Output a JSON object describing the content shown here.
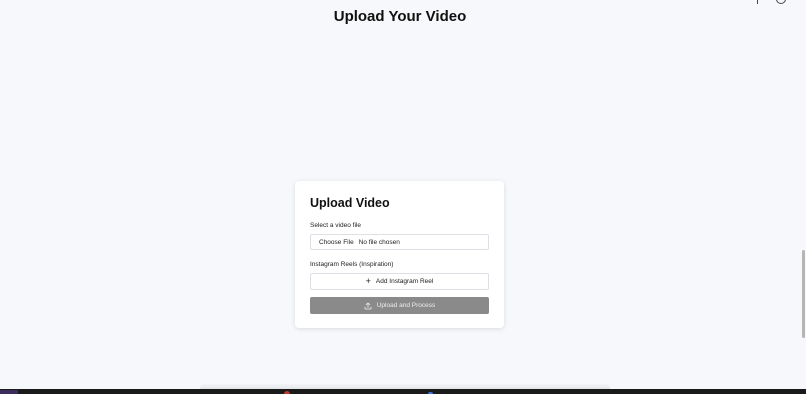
{
  "page": {
    "title": "Upload Your Video"
  },
  "card": {
    "title": "Upload Video",
    "video_label": "Select a video file",
    "file_button_label": "Choose File",
    "file_status": "No file chosen",
    "reels_label": "Instagram Reels (Inspiration)",
    "add_reel_label": "Add Instagram Reel",
    "submit_label": "Upload and Process",
    "submit_disabled": true
  },
  "icons": {
    "add": "plus-icon",
    "submit": "upload-icon"
  },
  "colors": {
    "background": "#f7f8fb",
    "card": "#ffffff",
    "submit_disabled": "#8a8a8a"
  }
}
